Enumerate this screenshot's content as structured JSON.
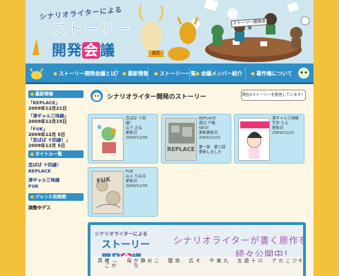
{
  "header": {
    "logo_sub": "シナリオライターによる",
    "logo_main1": "ストーリー",
    "logo_main2_a": "開発",
    "logo_main2_hl": "会",
    "logo_main2_b": "議",
    "sign": "ストーリー開発会議",
    "goat_badge": "議長"
  },
  "nav": {
    "items": [
      {
        "label": "ストーリー開発会議とは？"
      },
      {
        "label": "最新情報"
      },
      {
        "label": "ストーリー一覧"
      },
      {
        "label": "会議メンバー紹介"
      },
      {
        "label": "著作権について"
      }
    ]
  },
  "sidebar": {
    "news_head": "最新情報",
    "news": [
      {
        "title": "「REPLACE」",
        "date": "2009年12月21日"
      },
      {
        "title": "「津ギャル三味線」",
        "date": "2009年12月15日"
      },
      {
        "title": "「FUK」",
        "date": "2009年12月 5日"
      },
      {
        "title": "「恋ばば 十四歳！」",
        "date": "2009年12月 5日"
      }
    ],
    "titles_head": "タイトル一覧",
    "titles": [
      "恋ばば 十四歳！",
      "REPLACE",
      "津ギャル三味線",
      "FUK"
    ],
    "genre_head": "ジャンル別検索",
    "genre_item": "調整中デス"
  },
  "main": {
    "title": "シナリオライター開発のストーリー",
    "bubble": "現在4ストーリーを配信しています！",
    "cards": [
      {
        "lines": [
          "恋ばば 十四",
          "歳！",
          "山下 正弘",
          "更新日",
          "2009/12/05"
        ],
        "cover_text": ""
      },
      {
        "lines": [
          "REPLACE",
          "渡辺 千穂",
          "NEXT",
          "更新更新日",
          "2009/12/21",
          "",
          "第一部　第二回",
          "更新しました"
        ],
        "cover_text": "REPLACE"
      },
      {
        "lines": [
          "津ギャル三味線",
          "宇井 ちえ",
          "更新日",
          "2009/12/15"
        ],
        "cover_text": ""
      },
      {
        "lines": [
          "FUK",
          "山上 ちはる",
          "更新日",
          "2009/12/05"
        ],
        "cover_text": "FUK"
      }
    ]
  },
  "banner": {
    "logo_sub": "シナリオライターによる",
    "logo_main1": "ストーリー",
    "logo_main2_a": "開発",
    "logo_main2_hl": "会",
    "logo_main2_b": "議",
    "headline1": "シナリオライターが書く原作を",
    "headline2": "続々公開中！",
    "book_cols": [
      "高",
      "確ご",
      "「か",
      "母",
      "がな",
      "静",
      "お",
      "こ",
      "駆",
      "突",
      "広",
      "そ",
      "午",
      "東",
      "九",
      "五",
      "語",
      "十",
      "ロ",
      "ア",
      "だ",
      "こ",
      "少",
      "そ"
    ]
  },
  "colors": {
    "nav": "#2f8fc6",
    "frame": "#f3c23a",
    "accent_pink": "#e7357a",
    "logo_blue": "#1e6fb0"
  }
}
